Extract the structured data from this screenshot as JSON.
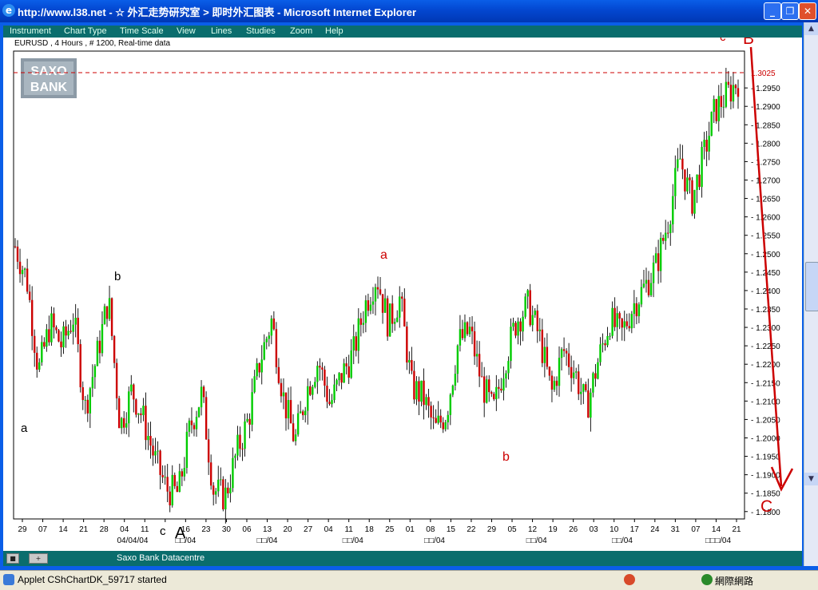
{
  "window": {
    "title": "http://www.l38.net - ☆ 外汇走势研究室 > 即时外汇图表 - Microsoft Internet Explorer",
    "icon": "ie-icon"
  },
  "menu": {
    "items": [
      "Instrument",
      "Chart Type",
      "Time Scale",
      "View",
      "Lines",
      "Studies",
      "Zoom",
      "Help"
    ]
  },
  "chart": {
    "header": "EURUSD , 4 Hours , # 1200, Real-time data",
    "logo_line1": "SAXO",
    "logo_line2": "BANK",
    "current_price_label": "1.3025",
    "footer_label": "Saxo Bank Datacentre"
  },
  "chart_data": {
    "type": "candlestick",
    "instrument": "EURUSD",
    "timeframe": "4 Hours",
    "y_ticks": [
      "1.3025",
      "1.2950",
      "1.2900",
      "1.2850",
      "1.2800",
      "1.2750",
      "1.2700",
      "1.2650",
      "1.2600",
      "1.2550",
      "1.2500",
      "1.2450",
      "1.2400",
      "1.2350",
      "1.2300",
      "1.2250",
      "1.2200",
      "1.2150",
      "1.2100",
      "1.2050",
      "1.2000",
      "1.1950",
      "1.1900",
      "1.1850",
      "1.1800"
    ],
    "ylim": [
      1.178,
      1.305
    ],
    "x_ticks": [
      "29",
      "07",
      "14",
      "21",
      "28",
      "04",
      "11",
      "",
      "16",
      "23",
      "30",
      "06",
      "13",
      "20",
      "27",
      "04",
      "11",
      "18",
      "25",
      "01",
      "08",
      "15",
      "22",
      "29",
      "05",
      "12",
      "19",
      "26",
      "03",
      "10",
      "17",
      "24",
      "31",
      "07",
      "14",
      "21"
    ],
    "month_labels": [
      "04/04/04",
      "□□/04",
      "□□/04",
      "□□/04",
      "□□/04",
      "□□/04",
      "□□/04",
      "□□□/04"
    ],
    "close_path": [
      1.252,
      1.243,
      1.218,
      1.231,
      1.225,
      1.233,
      1.208,
      1.222,
      1.238,
      1.203,
      1.213,
      1.205,
      1.194,
      1.186,
      1.185,
      1.203,
      1.212,
      1.186,
      1.184,
      1.196,
      1.205,
      1.221,
      1.232,
      1.211,
      1.199,
      1.213,
      1.221,
      1.209,
      1.217,
      1.223,
      1.236,
      1.244,
      1.231,
      1.238,
      1.214,
      1.211,
      1.202,
      1.207,
      1.226,
      1.229,
      1.215,
      1.207,
      1.221,
      1.232,
      1.236,
      1.227,
      1.212,
      1.224,
      1.218,
      1.208,
      1.221,
      1.232,
      1.228,
      1.236,
      1.241,
      1.247,
      1.259,
      1.276,
      1.264,
      1.276,
      1.289,
      1.293,
      1.297
    ]
  },
  "annotations": {
    "black": [
      "a",
      "b",
      "c",
      "A"
    ],
    "red": [
      "a",
      "b",
      "c",
      "B",
      "C"
    ]
  },
  "statusbar": {
    "text": "Applet CShChartDK_59717 started",
    "zone": "網際網路"
  },
  "colors": {
    "titlebar": "#0a5ee8",
    "teal_panel": "#0a6d6d",
    "bullish": "#00cc00",
    "bearish": "#cc0000",
    "annotation_red": "#cc0000"
  }
}
